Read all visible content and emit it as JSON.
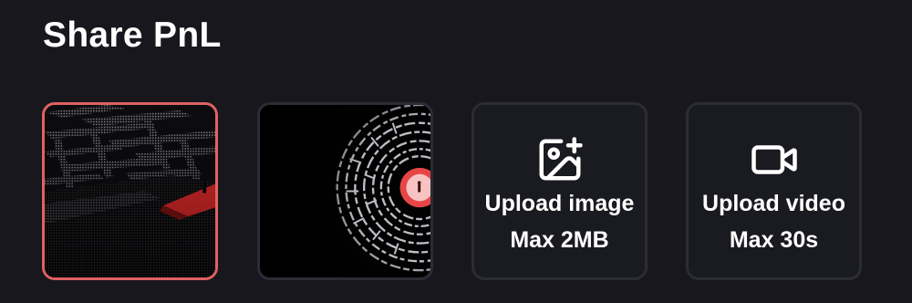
{
  "header": {
    "title": "Share PnL"
  },
  "backgrounds": [
    {
      "name": "maze-perspective-red",
      "selected": true,
      "accent": "#d62828"
    },
    {
      "name": "maze-circular-red",
      "selected": false,
      "accent": "#e23a3a"
    }
  ],
  "upload_image": {
    "icon": "image-plus-icon",
    "label": "Upload image",
    "limit": "Max 2MB"
  },
  "upload_video": {
    "icon": "video-camera-icon",
    "label": "Upload video",
    "limit": "Max 30s"
  },
  "colors": {
    "background": "#17171d",
    "card_border": "#2c2c36",
    "selected_border": "#e06262",
    "text": "#ffffff"
  }
}
